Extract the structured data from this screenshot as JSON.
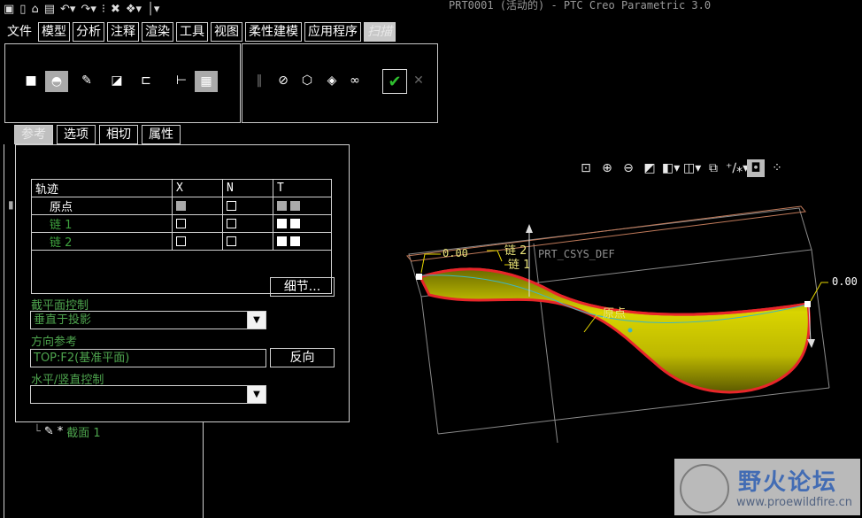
{
  "window": {
    "title": "PRT0001 (活动的) - PTC Creo Parametric 3.0"
  },
  "quick_access": [
    "new-icon",
    "open-icon",
    "save-icon",
    "undo-icon",
    "redo-icon",
    "regenerate-icon",
    "close-icon",
    "windows-icon",
    "customize-icon"
  ],
  "menu": [
    {
      "label": "文件",
      "plain": true
    },
    {
      "label": "模型"
    },
    {
      "label": "分析"
    },
    {
      "label": "注释"
    },
    {
      "label": "渲染"
    },
    {
      "label": "工具"
    },
    {
      "label": "视图"
    },
    {
      "label": "柔性建模"
    },
    {
      "label": "应用程序"
    },
    {
      "label": "扫描",
      "active": true
    }
  ],
  "tabs": [
    "参考",
    "选项",
    "相切",
    "属性"
  ],
  "trajectory_table": {
    "headers": [
      "轨迹",
      "X",
      "N",
      "T"
    ],
    "rows": [
      {
        "name": "原点"
      },
      {
        "name": "链 1"
      },
      {
        "name": "链 2"
      }
    ]
  },
  "details_button": "细节...",
  "section_plane": {
    "label": "截平面控制",
    "value": "垂直于投影"
  },
  "direction_ref": {
    "label": "方向参考",
    "value": "TOP:F2(基准平面)",
    "flip_button": "反向"
  },
  "hv_control": {
    "label": "水平/竖直控制",
    "value": ""
  },
  "tree": {
    "section_item": "截面 1"
  },
  "canvas": {
    "csys_label": "PRT_CSYS_DEF",
    "chain2": "链 2",
    "chain1": "链 1",
    "origin": "原点",
    "dim_left": "0.00",
    "dim_right": "0.00"
  },
  "watermark": {
    "title": "野火论坛",
    "url": "www.proewildfire.cn"
  },
  "colors": {
    "trajectory": "#e8262a",
    "surface": "#d9d400",
    "accent_green": "#4ea54e"
  }
}
